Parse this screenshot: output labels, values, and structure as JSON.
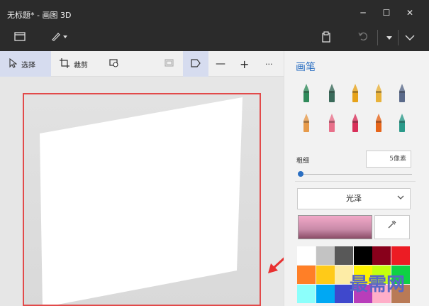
{
  "app": {
    "title": "无标题* - 画图 3D"
  },
  "window_controls": {
    "minimize": "─",
    "maximize": "☐",
    "close": "✕"
  },
  "toolbar": {
    "select_label": "选择",
    "crop_label": "裁剪",
    "zoom_out": "—",
    "zoom_in": "+",
    "more": "···"
  },
  "panel": {
    "title": "画笔",
    "thickness_label": "粗细",
    "thickness_value": "5像素",
    "thickness_level": 0.0,
    "finish_label": "光泽",
    "brushes": [
      {
        "name": "marker",
        "color": "#2f8a5a"
      },
      {
        "name": "calligraphy-pen",
        "color": "#3a6a5a"
      },
      {
        "name": "oil-brush",
        "color": "#e6a21a"
      },
      {
        "name": "watercolor",
        "color": "#e8b23a"
      },
      {
        "name": "pixel-pen",
        "color": "#5a6a8a"
      },
      {
        "name": "pencil",
        "color": "#e69a4a"
      },
      {
        "name": "eraser",
        "color": "#e8708a"
      },
      {
        "name": "crayon",
        "color": "#d8305a"
      },
      {
        "name": "spray-can",
        "color": "#e6651a"
      },
      {
        "name": "fill",
        "color": "#2a9a8a"
      }
    ],
    "swatches": [
      "#ffffff",
      "#c3c3c3",
      "#585858",
      "#000000",
      "#88001b",
      "#ec1c24",
      "#ff7f27",
      "#ffca18",
      "#fdeca6",
      "#fff200",
      "#c4ff0e",
      "#0ed145",
      "#8cfffb",
      "#00a8f3",
      "#3f48cc",
      "#b83dba",
      "#ffaec8",
      "#b97a56"
    ]
  },
  "watermark": "最需网",
  "accent": "#2b6fc2"
}
